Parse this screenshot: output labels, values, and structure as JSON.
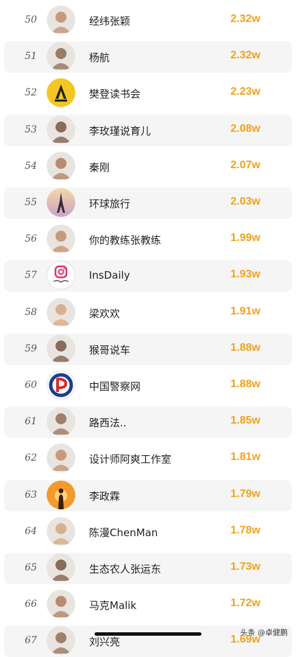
{
  "rows": [
    {
      "rank": "50",
      "name": "经纬张颖",
      "value": "2.32w",
      "avatar_icon": "person-photo-avatar",
      "alt": false
    },
    {
      "rank": "51",
      "name": "杨航",
      "value": "2.32w",
      "avatar_icon": "person-photo-avatar",
      "alt": true
    },
    {
      "rank": "52",
      "name": "樊登读书会",
      "value": "2.23w",
      "avatar_icon": "yellow-book-logo-avatar",
      "alt": false
    },
    {
      "rank": "53",
      "name": "李玫瑾说育儿",
      "value": "2.08w",
      "avatar_icon": "person-photo-avatar",
      "alt": true
    },
    {
      "rank": "54",
      "name": "秦刚",
      "value": "2.07w",
      "avatar_icon": "person-photo-avatar",
      "alt": false
    },
    {
      "rank": "55",
      "name": "环球旅行",
      "value": "2.03w",
      "avatar_icon": "eiffel-tower-avatar",
      "alt": true
    },
    {
      "rank": "56",
      "name": "你的教练张教练",
      "value": "1.99w",
      "avatar_icon": "person-photo-avatar",
      "alt": false
    },
    {
      "rank": "57",
      "name": "InsDaily",
      "value": "1.93w",
      "avatar_icon": "instagram-logo-avatar",
      "alt": true
    },
    {
      "rank": "58",
      "name": "梁欢欢",
      "value": "1.91w",
      "avatar_icon": "person-photo-avatar",
      "alt": false
    },
    {
      "rank": "59",
      "name": "猴哥说车",
      "value": "1.88w",
      "avatar_icon": "person-photo-avatar",
      "alt": true
    },
    {
      "rank": "60",
      "name": "中国警察网",
      "value": "1.88w",
      "avatar_icon": "police-logo-avatar",
      "alt": false
    },
    {
      "rank": "61",
      "name": "路西法..",
      "value": "1.85w",
      "avatar_icon": "person-photo-avatar",
      "alt": true
    },
    {
      "rank": "62",
      "name": "设计师阿爽工作室",
      "value": "1.81w",
      "avatar_icon": "person-photo-avatar",
      "alt": false
    },
    {
      "rank": "63",
      "name": "李政霖",
      "value": "1.79w",
      "avatar_icon": "sunset-silhouette-avatar",
      "alt": true
    },
    {
      "rank": "64",
      "name": "陈漫ChenMan",
      "value": "1.78w",
      "avatar_icon": "person-photo-avatar",
      "alt": false
    },
    {
      "rank": "65",
      "name": "生态农人张运东",
      "value": "1.73w",
      "avatar_icon": "person-photo-avatar",
      "alt": true
    },
    {
      "rank": "66",
      "name": "马克Malik",
      "value": "1.72w",
      "avatar_icon": "person-photo-avatar",
      "alt": false
    },
    {
      "rank": "67",
      "name": "刘兴亮",
      "value": "1.69w",
      "avatar_icon": "person-photo-avatar",
      "alt": true
    }
  ],
  "accent_color": "#f0a21a",
  "watermark": "头条 @卓健鹏"
}
